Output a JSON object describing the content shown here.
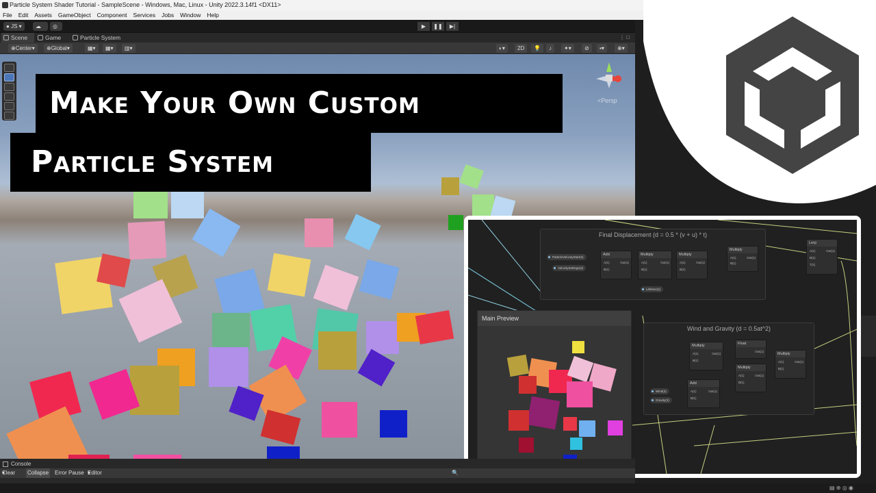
{
  "window": {
    "title": "Particle System Shader Tutorial - SampleScene - Windows, Mac, Linux - Unity 2022.3.14f1 <DX11>"
  },
  "menu": [
    "File",
    "Edit",
    "Assets",
    "GameObject",
    "Component",
    "Services",
    "Jobs",
    "Window",
    "Help"
  ],
  "toolbar": {
    "account": "JS",
    "play_icon": "▶",
    "pause_icon": "❚❚",
    "step_icon": "▶|"
  },
  "tabs": {
    "scene": "Scene",
    "game": "Game",
    "particle": "Particle System"
  },
  "scenebar": {
    "pivot": "Center",
    "space": "Global",
    "mode_2d": "2D"
  },
  "headline": {
    "line1": "Make Your  Own Custom",
    "line2": "Particle System"
  },
  "gizmo": {
    "label": "<Persp"
  },
  "graph": {
    "group1_title": "Final Displacement (d = 0.5 * (v + u) * t)",
    "group2_title": "Wind and Gravity (d = 0.5at^2)",
    "preview_title": "Main Preview",
    "nodes": {
      "add": "Add",
      "multiply": "Multiply",
      "lerp": "Lerp",
      "float": "Float"
    },
    "ports": {
      "a": "A(1)",
      "b": "B(1)",
      "out": "Out(1)",
      "t": "T(1)"
    },
    "pills": {
      "particle_velocity": "ParticleVelocityStart(3)",
      "velocity_start": "VelocitySettings(3)",
      "lifetime": "Lifetime(1)",
      "wind": "Wind(3)",
      "gravity": "Gravity(3)"
    }
  },
  "console": {
    "tab": "Console",
    "clear": "Clear",
    "collapse": "Collapse",
    "error_pause": "Error Pause",
    "editor": "Editor"
  },
  "colors": {
    "unity_dark": "#191919",
    "headline_bg": "#000000",
    "graph_bg": "#202020"
  }
}
